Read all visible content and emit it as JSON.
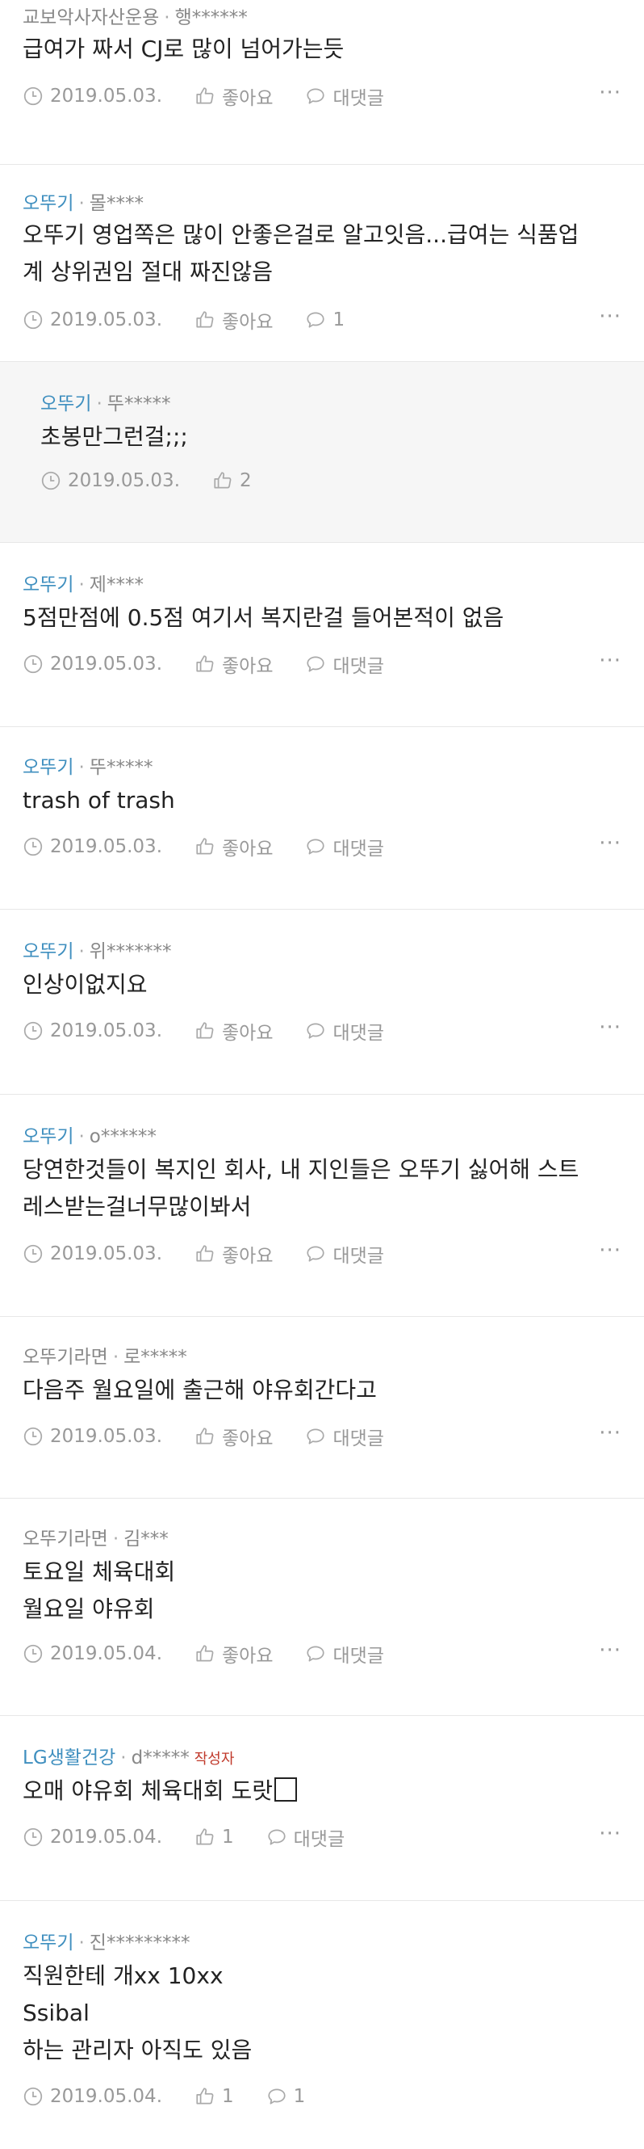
{
  "ui": {
    "like_label": "좋아요",
    "reply_label": "대댓글",
    "more_glyph": "···",
    "author_badge": "작성자",
    "author_sep": "·"
  },
  "comments": [
    {
      "company": "교보악사자산운용",
      "author": "행******",
      "body": [
        "급여가 짜서 CJ로 많이 넘어가는듯"
      ],
      "date": "2019.05.03.",
      "likes": "좋아요",
      "replies": "대댓글"
    },
    {
      "company": "오뚜기",
      "author": "몰****",
      "body": [
        "오뚜기 영업쪽은 많이 안좋은걸로 알고잇음...급여는 식품업",
        "계 상위권임 절대 짜진않음"
      ],
      "date": "2019.05.03.",
      "likes": "좋아요",
      "replies": "1"
    },
    {
      "company": "오뚜기",
      "author": "뚜*****",
      "body": [
        "초봉만그런걸;;;"
      ],
      "date": "2019.05.03.",
      "likes": "2",
      "reply": true
    },
    {
      "company": "오뚜기",
      "author": "제****",
      "body": [
        "5점만점에 0.5점 여기서 복지란걸 들어본적이 없음"
      ],
      "date": "2019.05.03.",
      "likes": "좋아요",
      "replies": "대댓글"
    },
    {
      "company": "오뚜기",
      "author": "뚜*****",
      "body": [
        "trash of trash"
      ],
      "date": "2019.05.03.",
      "likes": "좋아요",
      "replies": "대댓글"
    },
    {
      "company": "오뚜기",
      "author": "위*******",
      "body": [
        "인상이없지요"
      ],
      "date": "2019.05.03.",
      "likes": "좋아요",
      "replies": "대댓글"
    },
    {
      "company": "오뚜기",
      "author": "o******",
      "body": [
        "당연한것들이 복지인 회사, 내 지인들은 오뚜기 싫어해 스트",
        "레스받는걸너무많이봐서"
      ],
      "date": "2019.05.03.",
      "likes": "좋아요",
      "replies": "대댓글"
    },
    {
      "company": "오뚜기라면",
      "author": "로*****",
      "body": [
        "다음주 월요일에 출근해 야유회간다고"
      ],
      "date": "2019.05.03.",
      "likes": "좋아요",
      "replies": "대댓글"
    },
    {
      "company": "오뚜기라면",
      "author": "김***",
      "body": [
        "토요일 체육대회",
        "월요일 야유회"
      ],
      "date": "2019.05.04.",
      "likes": "좋아요",
      "replies": "대댓글"
    },
    {
      "company": "LG생활건강",
      "author": "d*****",
      "body": [
        "오매 야유회 체육대회 도랏"
      ],
      "date": "2019.05.04.",
      "likes": "1",
      "replies": "대댓글",
      "is_author": true
    },
    {
      "company": "오뚜기",
      "author": "진*********",
      "body": [
        "직원한테 개xx 10xx",
        "Ssibal",
        "하는 관리자 아직도 있음"
      ],
      "date": "2019.05.04.",
      "likes": "1",
      "replies": "1"
    }
  ]
}
